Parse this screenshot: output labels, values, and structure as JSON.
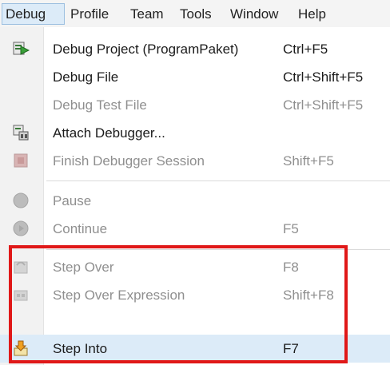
{
  "menubar": {
    "items": [
      {
        "label": "Debug",
        "open": true
      },
      {
        "label": "Profile"
      },
      {
        "label": "Team"
      },
      {
        "label": "Tools"
      },
      {
        "label": "Window"
      },
      {
        "label": "Help"
      }
    ]
  },
  "debug_menu": {
    "items": [
      {
        "label": "Debug Project (ProgramPaket)",
        "shortcut": "Ctrl+F5",
        "enabled": true,
        "icon": "debug-project-icon"
      },
      {
        "label": "Debug File",
        "shortcut": "Ctrl+Shift+F5",
        "enabled": true,
        "icon": ""
      },
      {
        "label": "Debug Test File",
        "shortcut": "Ctrl+Shift+F5",
        "enabled": false,
        "icon": ""
      },
      {
        "label": "Attach Debugger...",
        "shortcut": "",
        "enabled": true,
        "icon": "attach-debugger-icon"
      },
      {
        "label": "Finish Debugger Session",
        "shortcut": "Shift+F5",
        "enabled": false,
        "icon": "finish-session-icon"
      },
      {
        "label": "Pause",
        "shortcut": "",
        "enabled": false,
        "icon": "pause-icon"
      },
      {
        "label": "Continue",
        "shortcut": "F5",
        "enabled": false,
        "icon": "continue-icon"
      },
      {
        "label": "Step Over",
        "shortcut": "F8",
        "enabled": false,
        "icon": "step-over-icon"
      },
      {
        "label": "Step Over Expression",
        "shortcut": "Shift+F8",
        "enabled": false,
        "icon": "step-over-expression-icon"
      },
      {
        "label": "Step Into",
        "shortcut": "F7",
        "enabled": true,
        "highlighted": true,
        "icon": "step-into-icon"
      }
    ]
  },
  "colors": {
    "highlight": "#dcebf8",
    "annotation_border": "#e01818",
    "disabled_text": "#8f8f8f"
  }
}
